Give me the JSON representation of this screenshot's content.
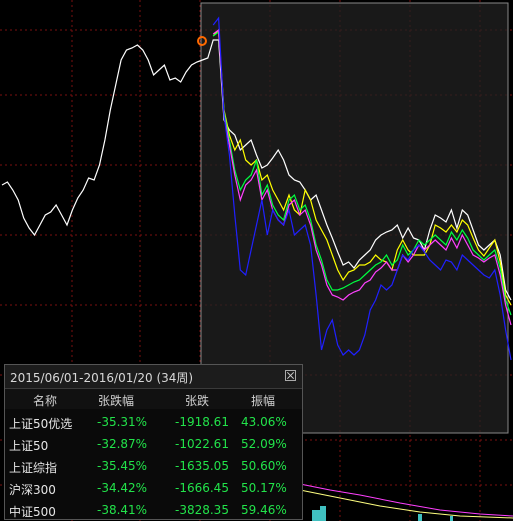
{
  "panel": {
    "title": "2015/06/01-2016/01/20 (34周)",
    "columns": [
      "名称",
      "张跌幅",
      "张跌",
      "振幅"
    ],
    "rows": [
      {
        "name": "上证50优选",
        "pct": "-35.31%",
        "change": "-1918.61",
        "amp": "43.06%"
      },
      {
        "name": "上证50",
        "pct": "-32.87%",
        "change": "-1022.61",
        "amp": "52.09%"
      },
      {
        "name": "上证综指",
        "pct": "-35.45%",
        "change": "-1635.05",
        "amp": "50.60%"
      },
      {
        "name": "沪深300",
        "pct": "-34.42%",
        "change": "-1666.45",
        "amp": "50.17%"
      },
      {
        "name": "中证500",
        "pct": "-38.41%",
        "change": "-3828.35",
        "amp": "59.46%"
      }
    ],
    "close_icon": "close-icon"
  },
  "chart_data": {
    "type": "line",
    "series": [
      {
        "color": "#ffffff",
        "values": [
          185,
          182,
          190,
          200,
          218,
          228,
          235,
          225,
          215,
          212,
          205,
          215,
          225,
          210,
          198,
          190,
          178,
          180,
          165,
          140,
          110,
          85,
          60,
          50,
          48,
          45,
          50,
          60,
          75,
          70,
          65,
          80,
          78,
          82,
          72,
          65,
          62,
          60,
          58,
          40,
          40,
          120,
          130,
          135,
          150,
          145,
          140,
          155,
          168,
          165,
          158,
          150,
          160,
          175,
          180,
          182,
          190,
          200,
          195,
          210,
          225,
          238,
          252,
          265,
          262,
          268,
          260,
          255,
          250,
          240,
          235,
          232,
          230,
          225,
          238,
          228,
          238,
          240,
          250,
          230,
          215,
          218,
          222,
          210,
          228,
          210,
          215,
          230,
          245,
          250,
          245,
          240,
          255,
          290,
          300
        ]
      },
      {
        "color": "#ffff00",
        "values": [
          null,
          null,
          null,
          null,
          null,
          null,
          null,
          null,
          null,
          null,
          null,
          null,
          null,
          null,
          null,
          null,
          null,
          null,
          null,
          null,
          null,
          null,
          null,
          null,
          null,
          null,
          null,
          null,
          null,
          null,
          null,
          null,
          null,
          null,
          null,
          null,
          null,
          null,
          null,
          36,
          30,
          110,
          135,
          150,
          140,
          160,
          165,
          160,
          180,
          175,
          190,
          200,
          210,
          195,
          210,
          215,
          190,
          200,
          220,
          230,
          240,
          255,
          270,
          280,
          272,
          270,
          265,
          265,
          262,
          255,
          260,
          262,
          270,
          250,
          240,
          250,
          255,
          255,
          255,
          245,
          225,
          228,
          232,
          225,
          232,
          220,
          225,
          238,
          250,
          256,
          248,
          240,
          262,
          295,
          305
        ]
      },
      {
        "color": "#00ff40",
        "values": [
          null,
          null,
          null,
          null,
          null,
          null,
          null,
          null,
          null,
          null,
          null,
          null,
          null,
          null,
          null,
          null,
          null,
          null,
          null,
          null,
          null,
          null,
          null,
          null,
          null,
          null,
          null,
          null,
          null,
          null,
          null,
          null,
          null,
          null,
          null,
          null,
          null,
          null,
          null,
          36,
          32,
          112,
          140,
          170,
          190,
          180,
          175,
          160,
          195,
          185,
          205,
          215,
          220,
          200,
          195,
          210,
          205,
          220,
          245,
          260,
          280,
          290,
          290,
          288,
          285,
          282,
          280,
          275,
          270,
          265,
          262,
          255,
          265,
          260,
          245,
          255,
          250,
          240,
          245,
          240,
          235,
          240,
          245,
          232,
          240,
          230,
          238,
          250,
          255,
          260,
          255,
          250,
          268,
          300,
          315
        ]
      },
      {
        "color": "#ff40ff",
        "values": [
          null,
          null,
          null,
          null,
          null,
          null,
          null,
          null,
          null,
          null,
          null,
          null,
          null,
          null,
          null,
          null,
          null,
          null,
          null,
          null,
          null,
          null,
          null,
          null,
          null,
          null,
          null,
          null,
          null,
          null,
          null,
          null,
          null,
          null,
          null,
          null,
          null,
          null,
          null,
          34,
          30,
          115,
          145,
          175,
          200,
          185,
          180,
          170,
          200,
          190,
          210,
          220,
          225,
          205,
          200,
          215,
          210,
          225,
          250,
          265,
          285,
          295,
          297,
          300,
          295,
          292,
          290,
          283,
          280,
          272,
          268,
          262,
          270,
          270,
          255,
          262,
          255,
          245,
          250,
          245,
          240,
          245,
          250,
          238,
          248,
          235,
          245,
          255,
          258,
          262,
          258,
          255,
          275,
          305,
          325
        ]
      },
      {
        "color": "#2020ff",
        "values": [
          null,
          null,
          null,
          null,
          null,
          null,
          null,
          null,
          null,
          null,
          null,
          null,
          null,
          null,
          null,
          null,
          null,
          null,
          null,
          null,
          null,
          null,
          null,
          null,
          null,
          null,
          null,
          null,
          null,
          null,
          null,
          null,
          null,
          null,
          null,
          null,
          null,
          null,
          null,
          25,
          18,
          115,
          155,
          215,
          270,
          275,
          250,
          225,
          200,
          235,
          210,
          220,
          225,
          210,
          235,
          230,
          225,
          245,
          295,
          350,
          330,
          320,
          345,
          355,
          350,
          355,
          350,
          335,
          310,
          300,
          285,
          290,
          285,
          270,
          255,
          260,
          250,
          245,
          252,
          260,
          265,
          270,
          260,
          262,
          270,
          255,
          260,
          265,
          270,
          275,
          278,
          270,
          295,
          330,
          360
        ]
      }
    ]
  }
}
